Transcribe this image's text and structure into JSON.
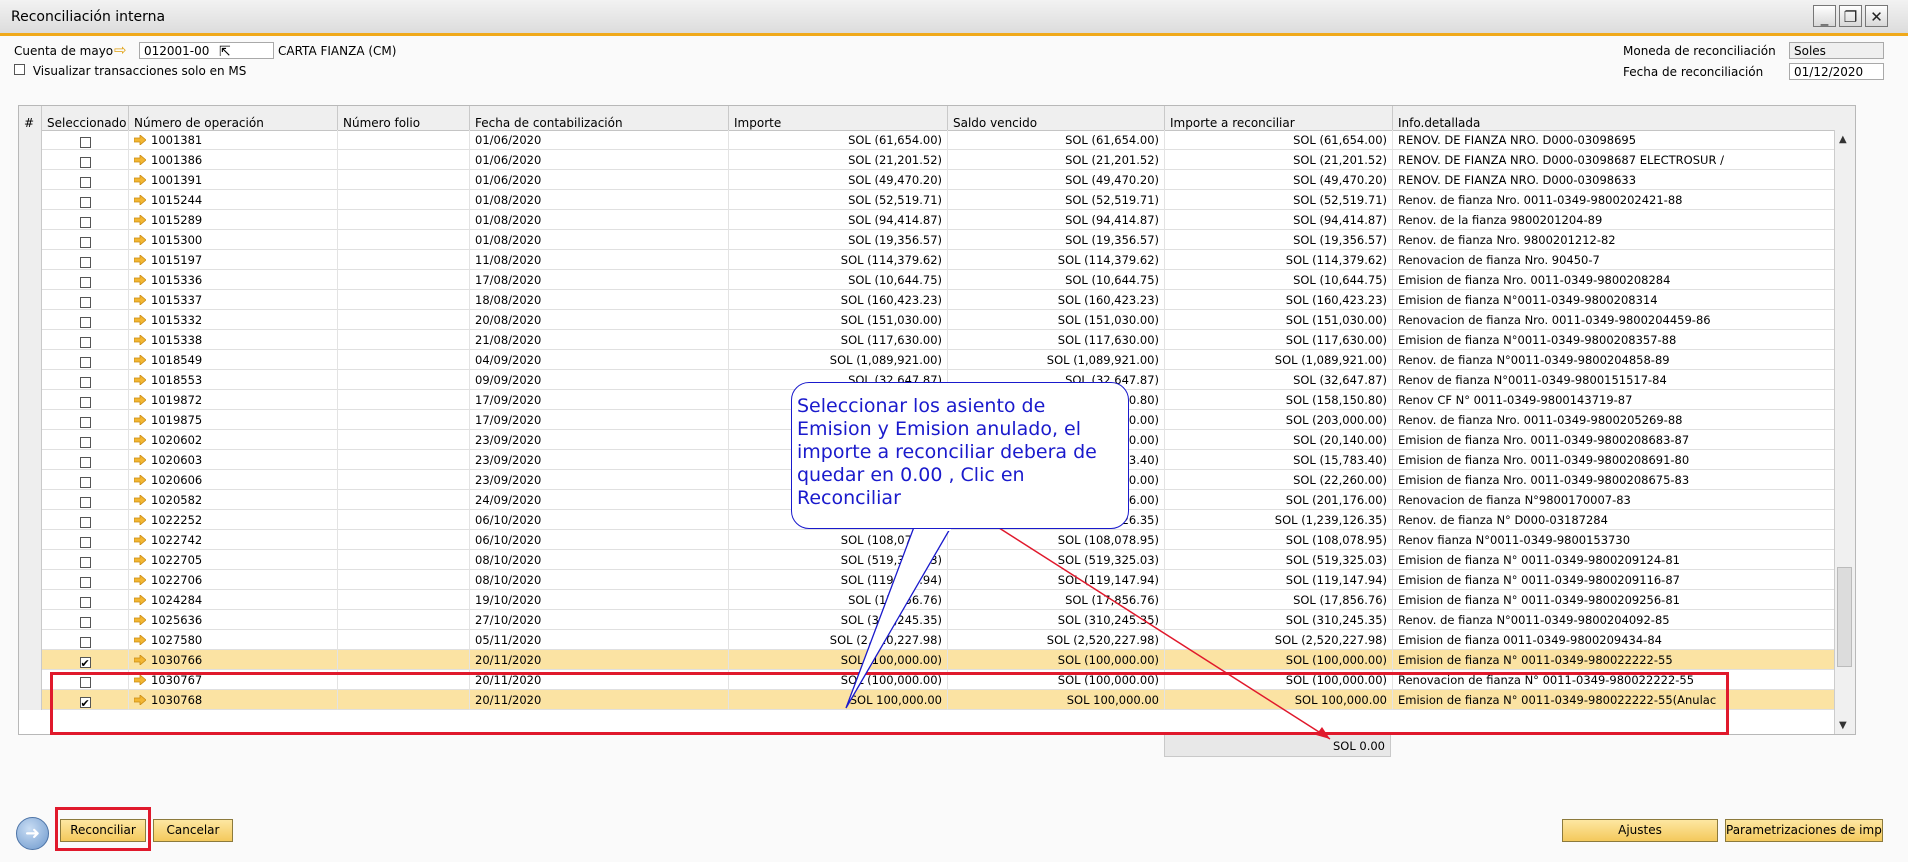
{
  "window": {
    "title": "Reconciliación interna",
    "controls": [
      "minimize-icon",
      "restore-icon",
      "close-icon"
    ]
  },
  "form": {
    "account_label": "Cuenta de mayo",
    "account_value": "012001-00",
    "account_name": "CARTA FIANZA (CM)",
    "ms_only_label": "Visualizar transacciones solo en MS",
    "currency_label": "Moneda de reconciliación",
    "currency_value": "Soles",
    "date_label": "Fecha de reconciliación",
    "date_value": "01/12/2020"
  },
  "columns": {
    "num": "#",
    "selected": "Seleccionado",
    "operation": "Número de operación",
    "folio": "Número folio",
    "posting_date": "Fecha de contabilización",
    "amount": "Importe",
    "balance_due": "Saldo vencido",
    "to_reconcile": "Importe a reconciliar",
    "details": "Info.detallada"
  },
  "rows": [
    {
      "sel": false,
      "op": "1001381",
      "date": "01/06/2020",
      "amount": "SOL (61,654.00)",
      "due": "SOL (61,654.00)",
      "rec": "SOL (61,654.00)",
      "info": "RENOV. DE FIANZA NRO. D000-03098695"
    },
    {
      "sel": false,
      "op": "1001386",
      "date": "01/06/2020",
      "amount": "SOL (21,201.52)",
      "due": "SOL (21,201.52)",
      "rec": "SOL (21,201.52)",
      "info": "RENOV. DE FIANZA NRO. D000-03098687 ELECTROSUR /"
    },
    {
      "sel": false,
      "op": "1001391",
      "date": "01/06/2020",
      "amount": "SOL (49,470.20)",
      "due": "SOL (49,470.20)",
      "rec": "SOL (49,470.20)",
      "info": "RENOV. DE FIANZA NRO. D000-03098633"
    },
    {
      "sel": false,
      "op": "1015244",
      "date": "01/08/2020",
      "amount": "SOL (52,519.71)",
      "due": "SOL (52,519.71)",
      "rec": "SOL (52,519.71)",
      "info": "Renov. de fianza Nro. 0011-0349-9800202421-88"
    },
    {
      "sel": false,
      "op": "1015289",
      "date": "01/08/2020",
      "amount": "SOL (94,414.87)",
      "due": "SOL (94,414.87)",
      "rec": "SOL (94,414.87)",
      "info": "Renov.  de la fianza 9800201204-89"
    },
    {
      "sel": false,
      "op": "1015300",
      "date": "01/08/2020",
      "amount": "SOL (19,356.57)",
      "due": "SOL (19,356.57)",
      "rec": "SOL (19,356.57)",
      "info": "Renov. de fianza Nro. 9800201212-82"
    },
    {
      "sel": false,
      "op": "1015197",
      "date": "11/08/2020",
      "amount": "SOL (114,379.62)",
      "due": "SOL (114,379.62)",
      "rec": "SOL (114,379.62)",
      "info": "Renovacion de fianza Nro. 90450-7"
    },
    {
      "sel": false,
      "op": "1015336",
      "date": "17/08/2020",
      "amount": "SOL (10,644.75)",
      "due": "SOL (10,644.75)",
      "rec": "SOL (10,644.75)",
      "info": "Emision de fianza Nro. 0011-0349-9800208284"
    },
    {
      "sel": false,
      "op": "1015337",
      "date": "18/08/2020",
      "amount": "SOL (160,423.23)",
      "due": "SOL (160,423.23)",
      "rec": "SOL (160,423.23)",
      "info": "Emision de fianza N°0011-0349-9800208314"
    },
    {
      "sel": false,
      "op": "1015332",
      "date": "20/08/2020",
      "amount": "SOL (151,030.00)",
      "due": "SOL (151,030.00)",
      "rec": "SOL (151,030.00)",
      "info": "Renovacion de fianza Nro. 0011-0349-9800204459-86"
    },
    {
      "sel": false,
      "op": "1015338",
      "date": "21/08/2020",
      "amount": "SOL (117,630.00)",
      "due": "SOL (117,630.00)",
      "rec": "SOL (117,630.00)",
      "info": "Emision de fianza N°0011-0349-9800208357-88"
    },
    {
      "sel": false,
      "op": "1018549",
      "date": "04/09/2020",
      "amount": "SOL (1,089,921.00)",
      "due": "SOL (1,089,921.00)",
      "rec": "SOL (1,089,921.00)",
      "info": "Renov. de fianza N°0011-0349-9800204858-89"
    },
    {
      "sel": false,
      "op": "1018553",
      "date": "09/09/2020",
      "amount": "SOL (32,647.87)",
      "due": "SOL (32,647.87)",
      "rec": "SOL (32,647.87)",
      "info": "Renov de fianza N°0011-0349-9800151517-84"
    },
    {
      "sel": false,
      "op": "1019872",
      "date": "17/09/2020",
      "amount": "SOL (158,150.80)",
      "due": "SOL (158,150.80)",
      "rec": "SOL (158,150.80)",
      "info": "Renov CF N° 0011-0349-9800143719-87"
    },
    {
      "sel": false,
      "op": "1019875",
      "date": "17/09/2020",
      "amount": "SOL (203,000.00)",
      "due": "SOL (203,000.00)",
      "rec": "SOL (203,000.00)",
      "info": "Renov. de fianza Nro. 0011-0349-9800205269-88"
    },
    {
      "sel": false,
      "op": "1020602",
      "date": "23/09/2020",
      "amount": "SOL (20,140.00)",
      "due": "SOL (20,140.00)",
      "rec": "SOL (20,140.00)",
      "info": "Emision de fianza Nro. 0011-0349-9800208683-87"
    },
    {
      "sel": false,
      "op": "1020603",
      "date": "23/09/2020",
      "amount": "SOL (15,783.40)",
      "due": "SOL (15,783.40)",
      "rec": "SOL (15,783.40)",
      "info": "Emision de fianza Nro. 0011-0349-9800208691-80"
    },
    {
      "sel": false,
      "op": "1020606",
      "date": "23/09/2020",
      "amount": "SOL (22,260.00)",
      "due": "SOL (22,260.00)",
      "rec": "SOL (22,260.00)",
      "info": "Emision de fianza Nro. 0011-0349-9800208675-83"
    },
    {
      "sel": false,
      "op": "1020582",
      "date": "24/09/2020",
      "amount": "SOL (201,176.00)",
      "due": "SOL (201,176.00)",
      "rec": "SOL (201,176.00)",
      "info": "Renovacion de fianza N°9800170007-83"
    },
    {
      "sel": false,
      "op": "1022252",
      "date": "06/10/2020",
      "amount": "SOL (1,239,126.35)",
      "due": "SOL (1,239,126.35)",
      "rec": "SOL (1,239,126.35)",
      "info": "Renov. de fianza N° D000-03187284"
    },
    {
      "sel": false,
      "op": "1022742",
      "date": "06/10/2020",
      "amount": "SOL (108,078.95)",
      "due": "SOL (108,078.95)",
      "rec": "SOL (108,078.95)",
      "info": "Renov fianza N°0011-0349-9800153730"
    },
    {
      "sel": false,
      "op": "1022705",
      "date": "08/10/2020",
      "amount": "SOL (519,325.03)",
      "due": "SOL (519,325.03)",
      "rec": "SOL (519,325.03)",
      "info": "Emision de fianza N° 0011-0349-9800209124-81"
    },
    {
      "sel": false,
      "op": "1022706",
      "date": "08/10/2020",
      "amount": "SOL (119,147.94)",
      "due": "SOL (119,147.94)",
      "rec": "SOL (119,147.94)",
      "info": "Emision de fianza N° 0011-0349-9800209116-87"
    },
    {
      "sel": false,
      "op": "1024284",
      "date": "19/10/2020",
      "amount": "SOL (17,856.76)",
      "due": "SOL (17,856.76)",
      "rec": "SOL (17,856.76)",
      "info": "Emision de fianza N° 0011-0349-9800209256-81"
    },
    {
      "sel": false,
      "op": "1025636",
      "date": "27/10/2020",
      "amount": "SOL (310,245.35)",
      "due": "SOL (310,245.35)",
      "rec": "SOL (310,245.35)",
      "info": "Renov. de fianza N°0011-0349-9800204092-85"
    },
    {
      "sel": false,
      "op": "1027580",
      "date": "05/11/2020",
      "amount": "SOL (2,520,227.98)",
      "due": "SOL (2,520,227.98)",
      "rec": "SOL (2,520,227.98)",
      "info": "Emision de fianza 0011-0349-9800209434-84"
    },
    {
      "sel": true,
      "op": "1030766",
      "date": "20/11/2020",
      "amount": "SOL (100,000.00)",
      "due": "SOL (100,000.00)",
      "rec": "SOL (100,000.00)",
      "info": "Emision de fianza N° 0011-0349-980022222-55"
    },
    {
      "sel": false,
      "op": "1030767",
      "date": "20/11/2020",
      "amount": "SOL (100,000.00)",
      "due": "SOL (100,000.00)",
      "rec": "SOL (100,000.00)",
      "info": "Renovacion de fianza N° 0011-0349-980022222-55"
    },
    {
      "sel": true,
      "op": "1030768",
      "date": "20/11/2020",
      "amount": "SOL  100,000.00",
      "due": "SOL  100,000.00",
      "rec": "SOL  100,000.00",
      "info": "Emision de fianza N° 0011-0349-980022222-55(Anulac"
    }
  ],
  "total": "SOL 0.00",
  "callout": "Seleccionar los asiento de Emision y Emision anulado, el importe a reconciliar debera de quedar en 0.00 , Clic en Reconciliar",
  "buttons": {
    "reconcile": "Reconciliar",
    "cancel": "Cancelar",
    "adjustments": "Ajustes",
    "parametrizations": "Parametrizaciones de impre"
  },
  "colors": {
    "accent": "#f0a91b",
    "selected_row": "#fbe3a3",
    "highlight_box": "#e0192c",
    "callout_text": "#1a1acc"
  }
}
